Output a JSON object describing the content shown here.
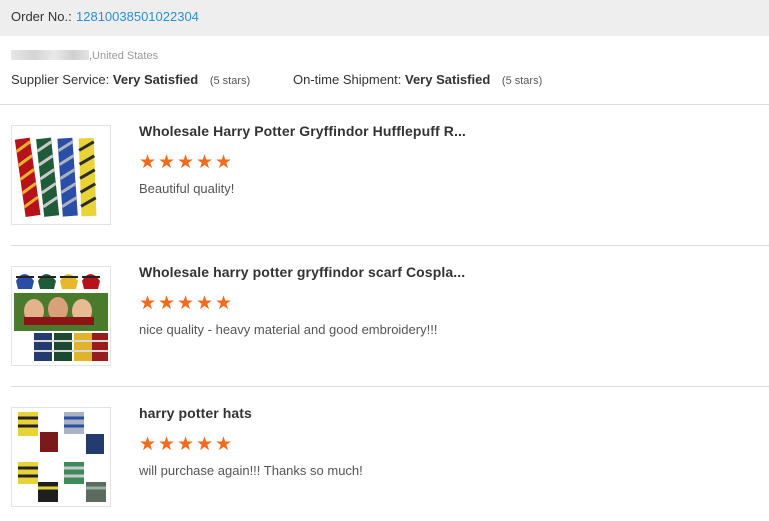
{
  "order": {
    "label": "Order No.:",
    "number": "12810038501022304"
  },
  "buyer": {
    "location": ",United States"
  },
  "ratings": {
    "supplier_label": "Supplier Service:",
    "supplier_value": "Very Satisfied",
    "supplier_stars": "(5 stars)",
    "shipment_label": "On-time Shipment:",
    "shipment_value": "Very Satisfied",
    "shipment_stars": "(5 stars)"
  },
  "star_color": "#f26a1b",
  "link_color": "#2a8fd6",
  "products": [
    {
      "title": "Wholesale Harry Potter Gryffindor Hufflepuff R...",
      "stars": 5,
      "comment": "Beautiful quality!",
      "image": "neckties"
    },
    {
      "title": "Wholesale harry potter gryffindor scarf Cospla...",
      "stars": 5,
      "comment": "nice quality - heavy material and good embroidery!!!",
      "image": "scarves"
    },
    {
      "title": "harry potter hats",
      "stars": 5,
      "comment": "will purchase again!!! Thanks so much!",
      "image": "hats"
    }
  ]
}
